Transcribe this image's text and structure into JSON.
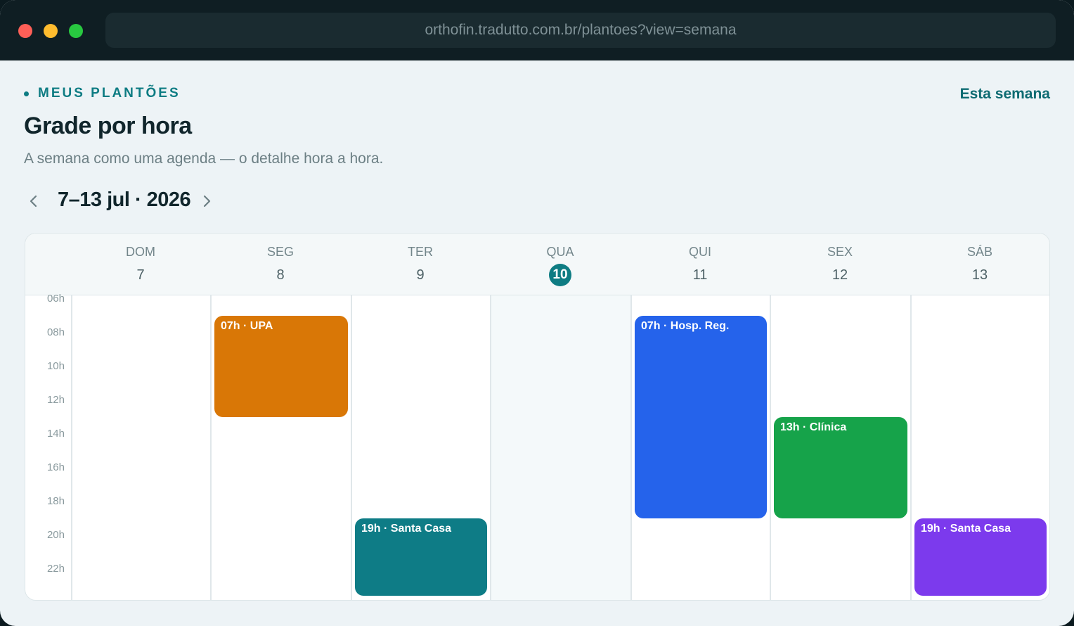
{
  "browser": {
    "url": "orthofin.tradutto.com.br/plantoes?view=semana"
  },
  "header": {
    "eyebrow": "MEUS PLANTÕES",
    "title": "Grade por hora",
    "subtitle": "A semana como uma agenda — o detalhe hora a hora.",
    "this_week_label": "Esta semana"
  },
  "week_nav": {
    "range_label": "7–13 jul · 2026"
  },
  "calendar": {
    "days": [
      {
        "dow": "DOM",
        "num": "7"
      },
      {
        "dow": "SEG",
        "num": "8"
      },
      {
        "dow": "TER",
        "num": "9"
      },
      {
        "dow": "QUA",
        "num": "10",
        "today": true
      },
      {
        "dow": "QUI",
        "num": "11"
      },
      {
        "dow": "SEX",
        "num": "12"
      },
      {
        "dow": "SÁB",
        "num": "13"
      }
    ],
    "hours": [
      "06h",
      "08h",
      "10h",
      "12h",
      "14h",
      "16h",
      "18h",
      "20h",
      "22h"
    ],
    "events": [
      {
        "day": 1,
        "start": 7,
        "end": 13,
        "label": "07h · UPA",
        "color": "#d97706"
      },
      {
        "day": 2,
        "start": 19,
        "end": 24,
        "label": "19h · Santa Casa",
        "color": "#0e7c86"
      },
      {
        "day": 4,
        "start": 7,
        "end": 19,
        "label": "07h · Hosp. Reg.",
        "color": "#2563eb"
      },
      {
        "day": 5,
        "start": 13,
        "end": 19,
        "label": "13h · Clínica",
        "color": "#16a34a"
      },
      {
        "day": 6,
        "start": 19,
        "end": 24,
        "label": "19h · Santa Casa",
        "color": "#7c3aed"
      }
    ]
  },
  "colors": {
    "accent": "#0e7c83"
  }
}
